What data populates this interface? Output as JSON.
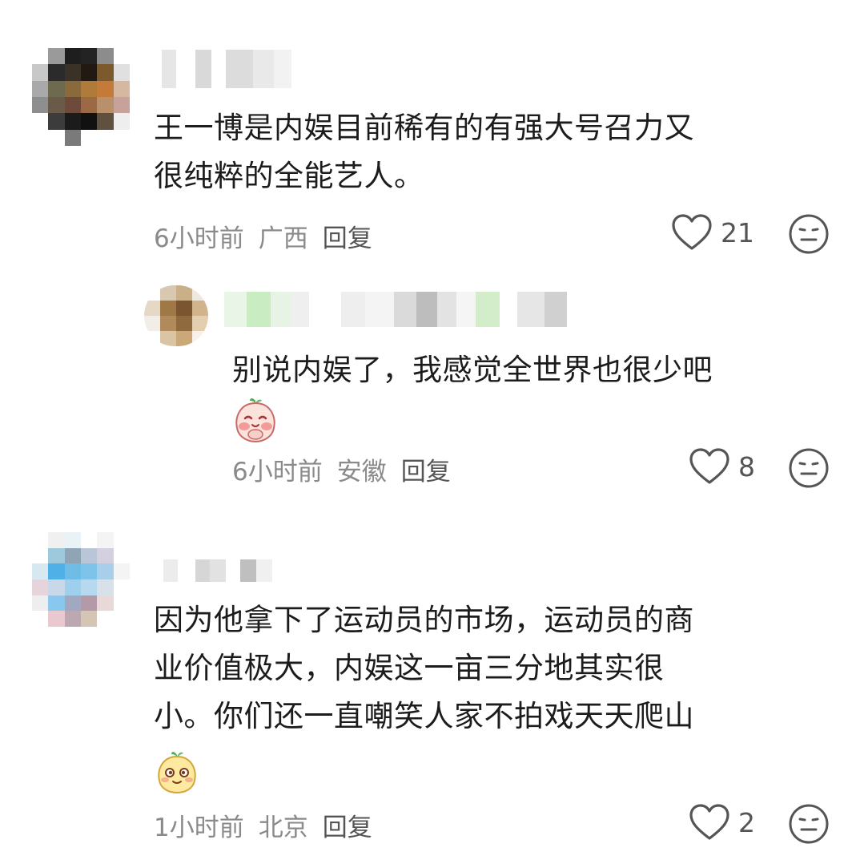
{
  "comments": [
    {
      "text": "王一博是内娱目前稀有的有强大号召力又\n很纯粹的全能艺人。",
      "time": "6小时前",
      "location": "广西",
      "reply_label": "回复",
      "likes": "21",
      "dislike_icon": "meh-face-icon",
      "like_icon": "heart-outline-icon"
    },
    {
      "text": "别说内娱了，我感觉全世界也很少吧",
      "time": "6小时前",
      "location": "安徽",
      "reply_label": "回复",
      "likes": "8",
      "sticker_icon": "blushing-peach-sticker",
      "dislike_icon": "meh-face-icon",
      "like_icon": "heart-outline-icon"
    },
    {
      "text": "因为他拿下了运动员的市场，运动员的商\n业价值极大，内娱这一亩三分地其实很\n小。你们还一直嘲笑人家不拍戏天天爬山",
      "time": "1小时前",
      "location": "北京",
      "reply_label": "回复",
      "likes": "2",
      "sticker_icon": "sneaky-peach-sticker",
      "dislike_icon": "meh-face-icon",
      "like_icon": "heart-outline-icon"
    }
  ],
  "colors": {
    "text": "#1c1c1c",
    "meta": "#8a8a8a",
    "icon": "#555555",
    "background": "#ffffff"
  }
}
